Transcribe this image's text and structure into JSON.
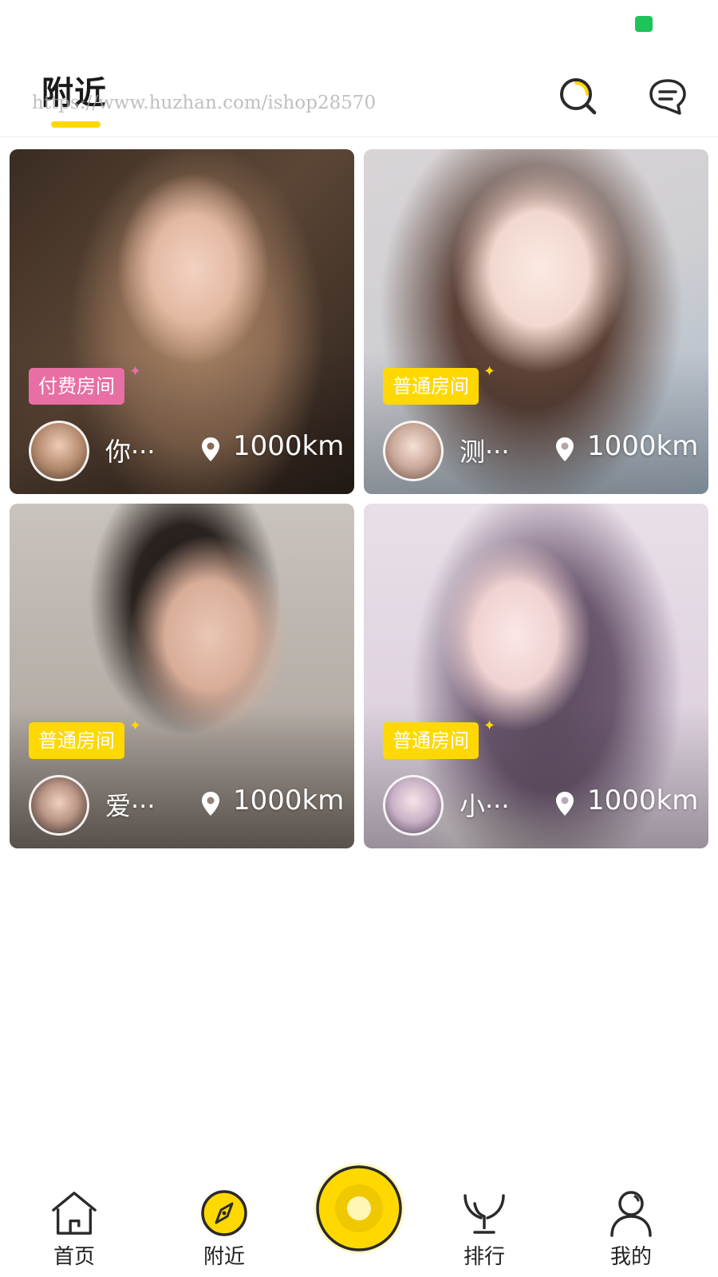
{
  "status_bar": {
    "indicator_color": "#1ec35a"
  },
  "header": {
    "title": "附近",
    "watermark": "https://www.huzhan.com/ishop28570",
    "accent_color": "#ffd800",
    "icons": [
      "search-icon",
      "message-icon"
    ]
  },
  "cards": [
    {
      "room_type": "付费房间",
      "badge_color": "#e86fa3",
      "name": "你···",
      "distance": "1000km",
      "photo_palette": [
        "#3a2c22",
        "#8b6a52",
        "#c7a088"
      ]
    },
    {
      "room_type": "普通房间",
      "badge_color": "#ffd800",
      "name": "测···",
      "distance": "1000km",
      "photo_palette": [
        "#d9d4d6",
        "#a9b9c7",
        "#e9d4cc"
      ]
    },
    {
      "room_type": "普通房间",
      "badge_color": "#ffd800",
      "name": "爱···",
      "distance": "1000km",
      "photo_palette": [
        "#c9c3bd",
        "#8f837a",
        "#3a3430"
      ]
    },
    {
      "room_type": "普通房间",
      "badge_color": "#ffd800",
      "name": "小···",
      "distance": "1000km",
      "photo_palette": [
        "#e8dfe8",
        "#d4c7d6",
        "#5b4a5e"
      ]
    }
  ],
  "bottom_nav": {
    "items": [
      {
        "label": "首页",
        "icon": "home-icon"
      },
      {
        "label": "附近",
        "icon": "compass-icon",
        "active": true
      },
      {
        "label": "排行",
        "icon": "trophy-icon"
      },
      {
        "label": "我的",
        "icon": "profile-icon"
      }
    ],
    "center_button": {
      "icon": "live-record-icon",
      "color": "#ffd800"
    }
  }
}
